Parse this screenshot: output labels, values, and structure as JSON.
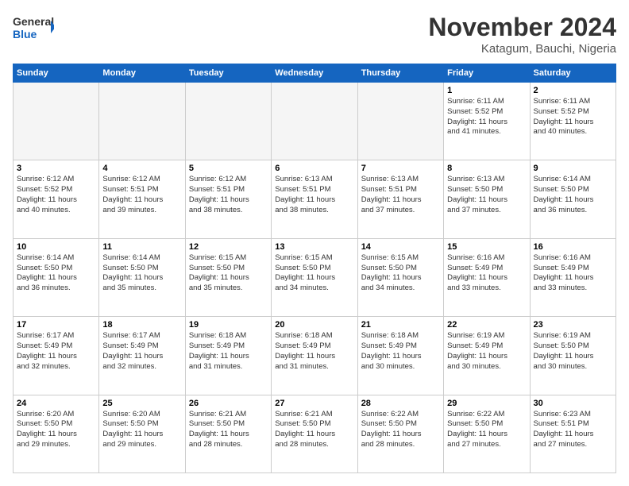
{
  "logo": {
    "line1": "General",
    "line2": "Blue"
  },
  "title": "November 2024",
  "subtitle": "Katagum, Bauchi, Nigeria",
  "days_header": [
    "Sunday",
    "Monday",
    "Tuesday",
    "Wednesday",
    "Thursday",
    "Friday",
    "Saturday"
  ],
  "weeks": [
    [
      {
        "day": "",
        "info": ""
      },
      {
        "day": "",
        "info": ""
      },
      {
        "day": "",
        "info": ""
      },
      {
        "day": "",
        "info": ""
      },
      {
        "day": "",
        "info": ""
      },
      {
        "day": "1",
        "info": "Sunrise: 6:11 AM\nSunset: 5:52 PM\nDaylight: 11 hours\nand 41 minutes."
      },
      {
        "day": "2",
        "info": "Sunrise: 6:11 AM\nSunset: 5:52 PM\nDaylight: 11 hours\nand 40 minutes."
      }
    ],
    [
      {
        "day": "3",
        "info": "Sunrise: 6:12 AM\nSunset: 5:52 PM\nDaylight: 11 hours\nand 40 minutes."
      },
      {
        "day": "4",
        "info": "Sunrise: 6:12 AM\nSunset: 5:51 PM\nDaylight: 11 hours\nand 39 minutes."
      },
      {
        "day": "5",
        "info": "Sunrise: 6:12 AM\nSunset: 5:51 PM\nDaylight: 11 hours\nand 38 minutes."
      },
      {
        "day": "6",
        "info": "Sunrise: 6:13 AM\nSunset: 5:51 PM\nDaylight: 11 hours\nand 38 minutes."
      },
      {
        "day": "7",
        "info": "Sunrise: 6:13 AM\nSunset: 5:51 PM\nDaylight: 11 hours\nand 37 minutes."
      },
      {
        "day": "8",
        "info": "Sunrise: 6:13 AM\nSunset: 5:50 PM\nDaylight: 11 hours\nand 37 minutes."
      },
      {
        "day": "9",
        "info": "Sunrise: 6:14 AM\nSunset: 5:50 PM\nDaylight: 11 hours\nand 36 minutes."
      }
    ],
    [
      {
        "day": "10",
        "info": "Sunrise: 6:14 AM\nSunset: 5:50 PM\nDaylight: 11 hours\nand 36 minutes."
      },
      {
        "day": "11",
        "info": "Sunrise: 6:14 AM\nSunset: 5:50 PM\nDaylight: 11 hours\nand 35 minutes."
      },
      {
        "day": "12",
        "info": "Sunrise: 6:15 AM\nSunset: 5:50 PM\nDaylight: 11 hours\nand 35 minutes."
      },
      {
        "day": "13",
        "info": "Sunrise: 6:15 AM\nSunset: 5:50 PM\nDaylight: 11 hours\nand 34 minutes."
      },
      {
        "day": "14",
        "info": "Sunrise: 6:15 AM\nSunset: 5:50 PM\nDaylight: 11 hours\nand 34 minutes."
      },
      {
        "day": "15",
        "info": "Sunrise: 6:16 AM\nSunset: 5:49 PM\nDaylight: 11 hours\nand 33 minutes."
      },
      {
        "day": "16",
        "info": "Sunrise: 6:16 AM\nSunset: 5:49 PM\nDaylight: 11 hours\nand 33 minutes."
      }
    ],
    [
      {
        "day": "17",
        "info": "Sunrise: 6:17 AM\nSunset: 5:49 PM\nDaylight: 11 hours\nand 32 minutes."
      },
      {
        "day": "18",
        "info": "Sunrise: 6:17 AM\nSunset: 5:49 PM\nDaylight: 11 hours\nand 32 minutes."
      },
      {
        "day": "19",
        "info": "Sunrise: 6:18 AM\nSunset: 5:49 PM\nDaylight: 11 hours\nand 31 minutes."
      },
      {
        "day": "20",
        "info": "Sunrise: 6:18 AM\nSunset: 5:49 PM\nDaylight: 11 hours\nand 31 minutes."
      },
      {
        "day": "21",
        "info": "Sunrise: 6:18 AM\nSunset: 5:49 PM\nDaylight: 11 hours\nand 30 minutes."
      },
      {
        "day": "22",
        "info": "Sunrise: 6:19 AM\nSunset: 5:49 PM\nDaylight: 11 hours\nand 30 minutes."
      },
      {
        "day": "23",
        "info": "Sunrise: 6:19 AM\nSunset: 5:50 PM\nDaylight: 11 hours\nand 30 minutes."
      }
    ],
    [
      {
        "day": "24",
        "info": "Sunrise: 6:20 AM\nSunset: 5:50 PM\nDaylight: 11 hours\nand 29 minutes."
      },
      {
        "day": "25",
        "info": "Sunrise: 6:20 AM\nSunset: 5:50 PM\nDaylight: 11 hours\nand 29 minutes."
      },
      {
        "day": "26",
        "info": "Sunrise: 6:21 AM\nSunset: 5:50 PM\nDaylight: 11 hours\nand 28 minutes."
      },
      {
        "day": "27",
        "info": "Sunrise: 6:21 AM\nSunset: 5:50 PM\nDaylight: 11 hours\nand 28 minutes."
      },
      {
        "day": "28",
        "info": "Sunrise: 6:22 AM\nSunset: 5:50 PM\nDaylight: 11 hours\nand 28 minutes."
      },
      {
        "day": "29",
        "info": "Sunrise: 6:22 AM\nSunset: 5:50 PM\nDaylight: 11 hours\nand 27 minutes."
      },
      {
        "day": "30",
        "info": "Sunrise: 6:23 AM\nSunset: 5:51 PM\nDaylight: 11 hours\nand 27 minutes."
      }
    ]
  ]
}
